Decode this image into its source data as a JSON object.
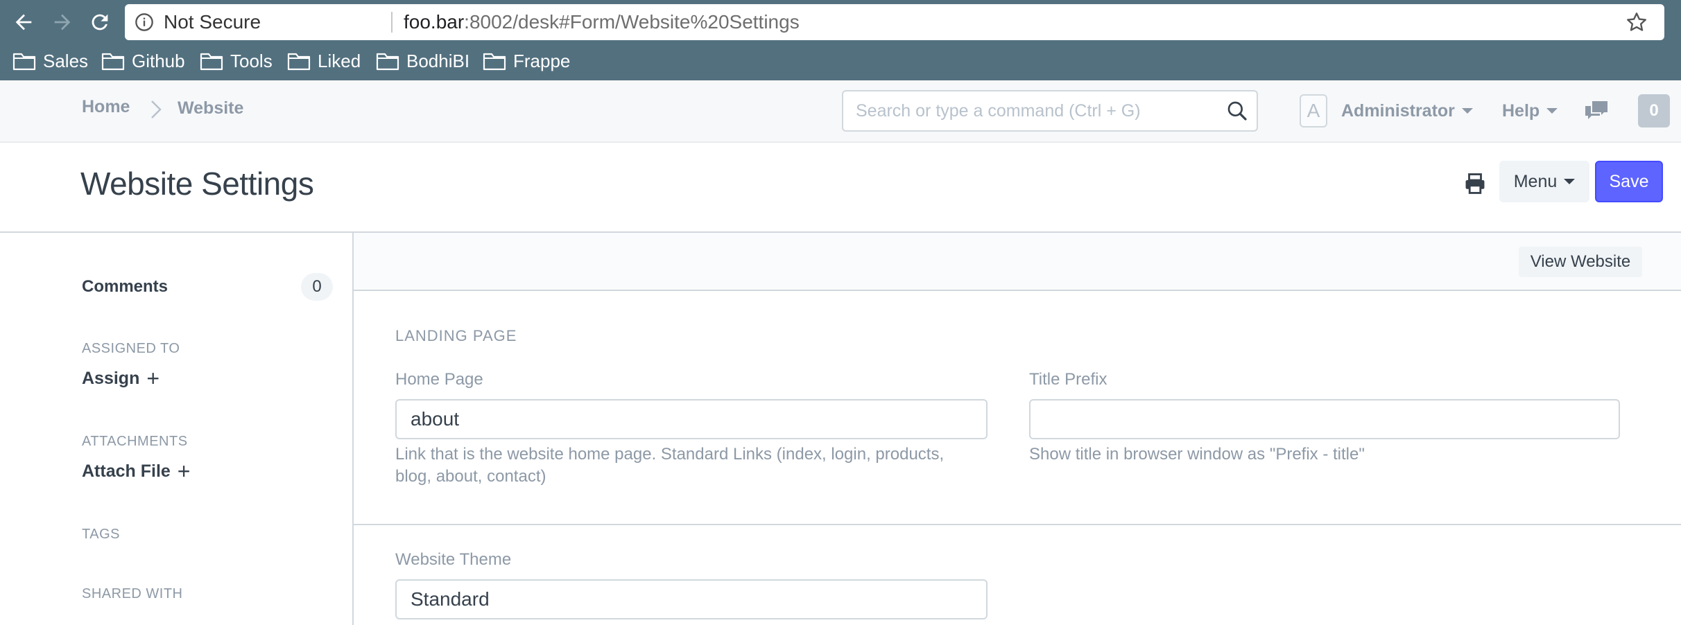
{
  "browser": {
    "security_label": "Not Secure",
    "url_host": "foo.bar",
    "url_rest": ":8002/desk#Form/Website%20Settings",
    "bookmarks": [
      {
        "label": "Sales"
      },
      {
        "label": "Github"
      },
      {
        "label": "Tools"
      },
      {
        "label": "Liked"
      },
      {
        "label": "BodhiBI"
      },
      {
        "label": "Frappe"
      }
    ]
  },
  "navbar": {
    "breadcrumb_home": "Home",
    "breadcrumb_current": "Website",
    "search_placeholder": "Search or type a command (Ctrl + G)",
    "avatar_letter": "A",
    "user_name": "Administrator",
    "help_label": "Help",
    "notification_count": "0"
  },
  "page": {
    "title": "Website Settings",
    "menu_label": "Menu",
    "save_label": "Save"
  },
  "sidebar": {
    "comments_label": "Comments",
    "comments_count": "0",
    "assigned_to_label": "ASSIGNED TO",
    "assign_label": "Assign",
    "attachments_label": "ATTACHMENTS",
    "attach_label": "Attach File",
    "tags_label": "TAGS",
    "shared_with_label": "SHARED WITH"
  },
  "form": {
    "view_website_label": "View Website",
    "section_landing": "LANDING PAGE",
    "home_page": {
      "label": "Home Page",
      "value": "about",
      "help": "Link that is the website home page. Standard Links (index, login, products,",
      "help_line2": "blog, about, contact)"
    },
    "title_prefix": {
      "label": "Title Prefix",
      "value": "",
      "help": "Show title in browser window as \"Prefix - title\""
    },
    "website_theme": {
      "label": "Website Theme",
      "value": "Standard"
    }
  },
  "colors": {
    "chrome": "#53707f",
    "primary": "#5e64ff",
    "muted_text": "#8d99a6",
    "text": "#36414c",
    "border": "#d1d8dd"
  },
  "icons": [
    "back-icon",
    "forward-icon",
    "reload-icon",
    "info-icon",
    "star-icon",
    "folder-icon",
    "chevron-right-icon",
    "search-icon",
    "chat-icon",
    "printer-icon",
    "plus-icon"
  ]
}
